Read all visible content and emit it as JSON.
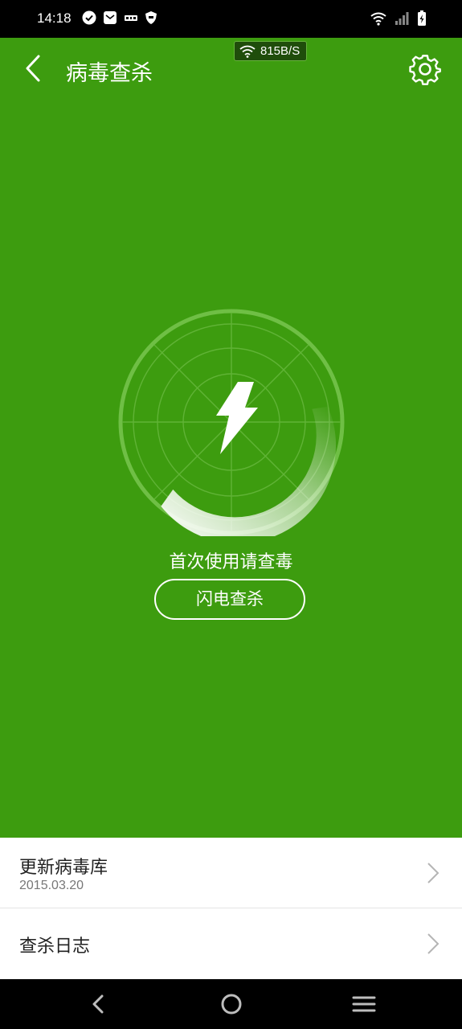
{
  "status_bar": {
    "time": "14:18",
    "left_icons": [
      "check-circle-icon",
      "mail-icon",
      "app-notification-icon",
      "shield-icon"
    ],
    "right_icons": [
      "wifi-icon",
      "signal-icon",
      "battery-charging-icon"
    ]
  },
  "header": {
    "title": "病毒查杀",
    "back_icon": "chevron-left-icon",
    "settings_icon": "gear-icon",
    "net_speed": "815B/S"
  },
  "scanner": {
    "hint": "首次使用请查毒",
    "button_label": "闪电查杀",
    "icon": "lightning-icon"
  },
  "list": {
    "update": {
      "title": "更新病毒库",
      "subtitle": "2015.03.20"
    },
    "log": {
      "title": "查杀日志"
    }
  },
  "nav_bar": {
    "icons": [
      "back-triangle-icon",
      "home-circle-icon",
      "menu-icon"
    ]
  },
  "colors": {
    "primary_green": "#3d9c0f",
    "white": "#ffffff",
    "status_black": "#000000"
  }
}
